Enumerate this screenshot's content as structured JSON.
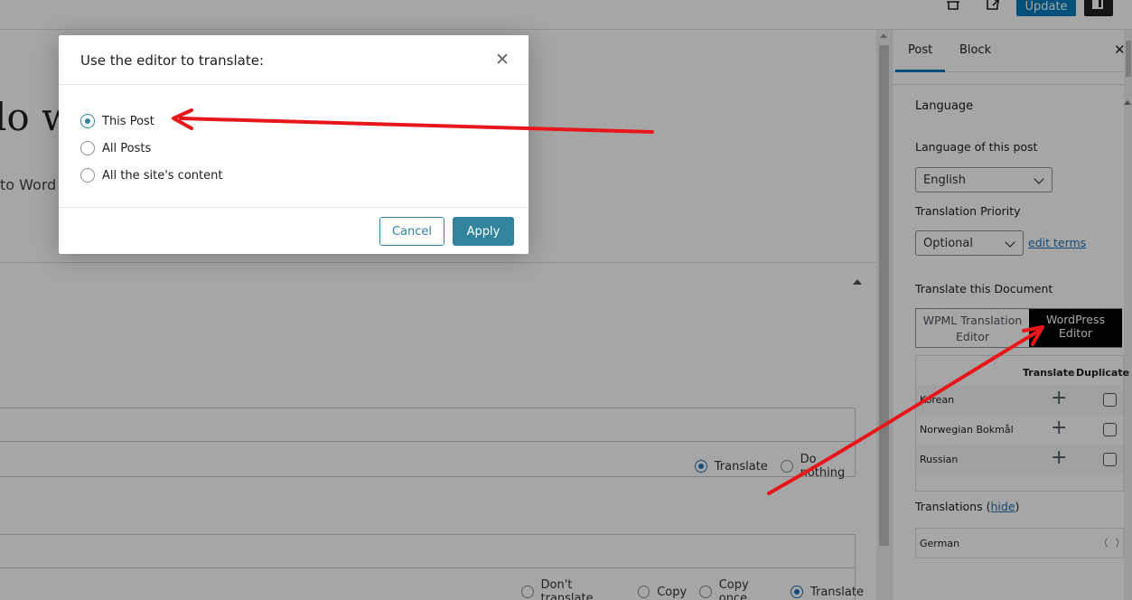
{
  "topbar": {
    "update_label": "Update"
  },
  "canvas": {
    "title_fragment": "lo w",
    "subtitle_fragment": "to Word",
    "row1_options": [
      {
        "label": "Translate",
        "selected": true
      },
      {
        "label": "Do nothing",
        "selected": false
      }
    ],
    "row2_options": [
      {
        "label": "Don't translate",
        "selected": false
      },
      {
        "label": "Copy",
        "selected": false
      },
      {
        "label": "Copy once",
        "selected": false
      },
      {
        "label": "Translate",
        "selected": true
      }
    ]
  },
  "sidebar": {
    "tabs": [
      {
        "label": "Post",
        "active": true
      },
      {
        "label": "Block",
        "active": false
      }
    ],
    "close_glyph": "✕",
    "language_heading": "Language",
    "language_of_post_label": "Language of this post",
    "language_value": "English",
    "translation_priority_label": "Translation Priority",
    "priority_value": "Optional",
    "edit_terms_link": "edit terms",
    "translate_doc_label": "Translate this Document",
    "editor_switch": {
      "wpml_label": "WPML Translation Editor",
      "wp_label": "WordPress Editor"
    },
    "table_headers": {
      "translate": "Translate",
      "duplicate": "Duplicate"
    },
    "languages": [
      {
        "name": "Korean"
      },
      {
        "name": "Norwegian Bokmål"
      },
      {
        "name": "Russian"
      }
    ],
    "translations_label": "Translations",
    "hide_link": "hide",
    "translations": [
      {
        "name": "German"
      }
    ]
  },
  "modal": {
    "title": "Use the editor to translate:",
    "close_glyph": "✕",
    "options": [
      {
        "label": "This Post",
        "selected": true
      },
      {
        "label": "All Posts",
        "selected": false
      },
      {
        "label": "All the site's content",
        "selected": false
      }
    ],
    "cancel_label": "Cancel",
    "apply_label": "Apply"
  },
  "colors": {
    "wp_blue": "#007cba",
    "modal_accent": "#31849b",
    "annotation_red": "#e8161b"
  }
}
